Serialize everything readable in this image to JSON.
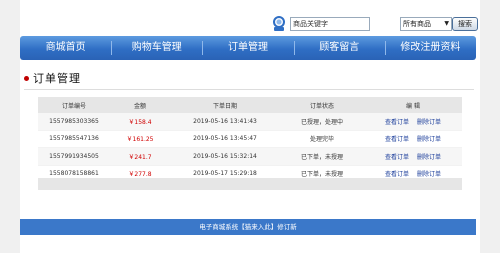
{
  "search": {
    "placeholder": "商品关键字",
    "category_selected": "所有商品",
    "button_label": "搜索"
  },
  "nav": {
    "items": [
      "商城首页",
      "购物车管理",
      "订单管理",
      "顾客留言",
      "修改注册资料"
    ]
  },
  "section_title": "订单管理",
  "orders_table": {
    "headers": [
      "订单编号",
      "金额",
      "下单日期",
      "订单状态",
      "编 辑"
    ],
    "rows": [
      {
        "id": "1557985303365",
        "amount": "￥158.4",
        "date": "2019-05-16 13:41:43",
        "status": "已授理，处理中",
        "actions": [
          "查看订单",
          "删除订单"
        ]
      },
      {
        "id": "1557985547136",
        "amount": "￥161.25",
        "date": "2019-05-16 13:45:47",
        "status": "处理完毕",
        "actions": [
          "查看订单",
          "删除订单"
        ]
      },
      {
        "id": "1557991934505",
        "amount": "￥241.7",
        "date": "2019-05-16 15:32:14",
        "status": "已下单，未授理",
        "actions": [
          "查看订单",
          "删除订单"
        ]
      },
      {
        "id": "1558078158861",
        "amount": "￥277.8",
        "date": "2019-05-17 15:29:18",
        "status": "已下单，未授理",
        "actions": [
          "查看订单",
          "删除订单"
        ]
      }
    ]
  },
  "footer": {
    "text": "电子商城系统【猫来入此】修订新"
  },
  "colors": {
    "nav_blue": "#2f6ec4",
    "footer_blue": "#3b78c9",
    "amount_red": "#d00000",
    "link_blue": "#1a3c9a"
  }
}
